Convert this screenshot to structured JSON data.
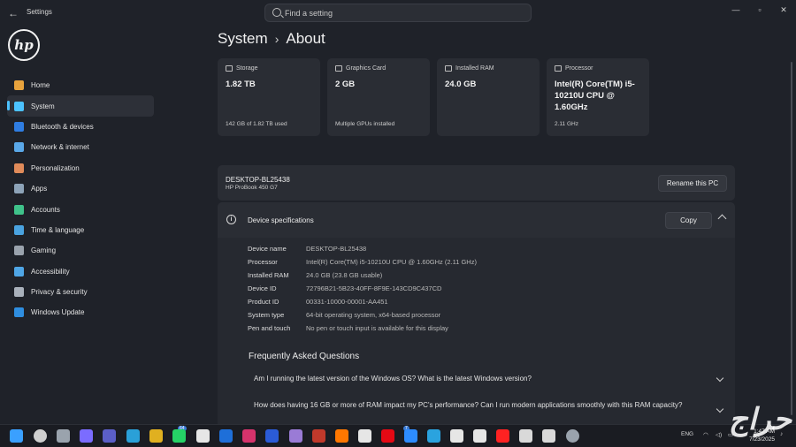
{
  "window": {
    "app_title": "Settings"
  },
  "search": {
    "placeholder": "Find a setting"
  },
  "logo": {
    "text": "hp"
  },
  "sidebar": {
    "items": [
      {
        "label": "Home",
        "color": "#e8a33d",
        "active": false
      },
      {
        "label": "System",
        "color": "#4cc2ff",
        "active": true
      },
      {
        "label": "Bluetooth & devices",
        "color": "#2f7de1",
        "active": false
      },
      {
        "label": "Network & internet",
        "color": "#5aa8e8",
        "active": false
      },
      {
        "label": "Personalization",
        "color": "#e08b5a",
        "active": false
      },
      {
        "label": "Apps",
        "color": "#8da3b8",
        "active": false
      },
      {
        "label": "Accounts",
        "color": "#3fc28a",
        "active": false
      },
      {
        "label": "Time & language",
        "color": "#4aa3e0",
        "active": false
      },
      {
        "label": "Gaming",
        "color": "#9aa3ad",
        "active": false
      },
      {
        "label": "Accessibility",
        "color": "#4fa6e6",
        "active": false
      },
      {
        "label": "Privacy & security",
        "color": "#a9b1bb",
        "active": false
      },
      {
        "label": "Windows Update",
        "color": "#2f8ee0",
        "active": false
      }
    ]
  },
  "breadcrumb": {
    "parent": "System",
    "separator": "›",
    "current": "About"
  },
  "cards": [
    {
      "label": "Storage",
      "value": "1.82 TB",
      "sub": "142 GB of 1.82 TB used"
    },
    {
      "label": "Graphics Card",
      "value": "2 GB",
      "sub": "Multiple GPUs installed"
    },
    {
      "label": "Installed RAM",
      "value": "24.0 GB",
      "sub": ""
    },
    {
      "label": "Processor",
      "value": "Intel(R) Core(TM) i5-10210U CPU @ 1.60GHz",
      "sub": "2.11 GHz"
    }
  ],
  "pc": {
    "name": "DESKTOP-BL25438",
    "model": "HP ProBook 450 G7",
    "rename_label": "Rename this PC"
  },
  "specs": {
    "title": "Device specifications",
    "copy_label": "Copy",
    "rows": [
      {
        "key": "Device name",
        "value": "DESKTOP-BL25438"
      },
      {
        "key": "Processor",
        "value": "Intel(R) Core(TM) i5-10210U CPU @ 1.60GHz (2.11 GHz)"
      },
      {
        "key": "Installed RAM",
        "value": "24.0 GB (23.8 GB usable)"
      },
      {
        "key": "Device ID",
        "value": "72796B21-5B23-40FF-8F9E-143CD9C437CD"
      },
      {
        "key": "Product ID",
        "value": "00331-10000-00001-AA451"
      },
      {
        "key": "System type",
        "value": "64-bit operating system, x64-based processor"
      },
      {
        "key": "Pen and touch",
        "value": "No pen or touch input is available for this display"
      }
    ]
  },
  "faq": {
    "title": "Frequently Asked Questions",
    "items": [
      "Am I running the latest version of the Windows OS? What is the latest Windows version?",
      "How does having 16 GB or more of RAM impact my PC's performance? Can I run modern applications smoothly with this RAM capacity?"
    ]
  },
  "taskbar": {
    "icons": [
      {
        "name": "start-icon",
        "color": "#3aa0ff"
      },
      {
        "name": "search-icon",
        "color": "#cfcfcf"
      },
      {
        "name": "task-view-icon",
        "color": "#9aa3ad"
      },
      {
        "name": "copilot-icon",
        "color": "#7b6cff"
      },
      {
        "name": "teams-icon",
        "color": "#5b5fc7"
      },
      {
        "name": "edge-icon",
        "color": "#2aa0d8"
      },
      {
        "name": "chrome-icon",
        "color": "#e0b020"
      },
      {
        "name": "whatsapp-icon",
        "color": "#25d366"
      },
      {
        "name": "calendar-icon",
        "color": "#e6e6e6"
      },
      {
        "name": "outlook-icon",
        "color": "#1e6fd9"
      },
      {
        "name": "instagram-icon",
        "color": "#d6336c"
      },
      {
        "name": "word-icon",
        "color": "#2b5bd7"
      },
      {
        "name": "photos-icon",
        "color": "#9a7bd6"
      },
      {
        "name": "game-icon",
        "color": "#c0392b"
      },
      {
        "name": "soundcloud-icon",
        "color": "#ff7700"
      },
      {
        "name": "app-icon",
        "color": "#e6e6e6"
      },
      {
        "name": "netflix-icon",
        "color": "#e50914"
      },
      {
        "name": "messenger-icon",
        "color": "#2d8cff"
      },
      {
        "name": "telegram-icon",
        "color": "#2aa3df"
      },
      {
        "name": "github-icon",
        "color": "#e6e6e6"
      },
      {
        "name": "tiktok-icon",
        "color": "#e6e6e6"
      },
      {
        "name": "youtube-icon",
        "color": "#ff2222"
      },
      {
        "name": "chatgpt-icon",
        "color": "#d9d9d9"
      },
      {
        "name": "openai-icon",
        "color": "#d9d9d9"
      },
      {
        "name": "settings-icon",
        "color": "#9aa3ad"
      }
    ],
    "badge_whatsapp": "64",
    "badge_messenger": "7"
  },
  "tray": {
    "language": "ENG",
    "time": "1:47 AM",
    "date": "7/23/2025"
  },
  "watermark": {
    "text": "حراج"
  }
}
